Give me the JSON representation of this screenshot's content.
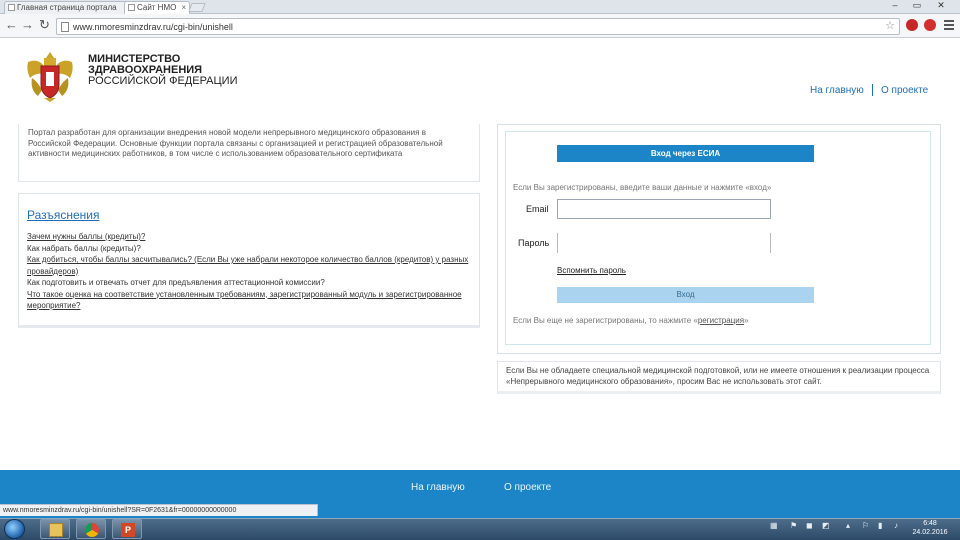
{
  "browser": {
    "tabs": [
      {
        "label": "Главная страница портала"
      },
      {
        "label": "Сайт НМО"
      }
    ],
    "url": "www.nmoresminzdrav.ru/cgi-bin/unishell"
  },
  "header": {
    "logo_lines": [
      "МИНИСТЕРСТВО",
      "ЗДРАВООХРАНЕНИЯ",
      "РОССИЙСКОЙ ФЕДЕРАЦИИ"
    ],
    "nav": [
      {
        "label": "На главную"
      },
      {
        "label": "О проекте"
      }
    ]
  },
  "about": {
    "text": "Портал разработан для организации внедрения новой модели непрерывного медицинского образования в Российской Федерации. Основные функции портала связаны с организацией и регистрацией образовательной активности медицинских работников, в том числе с использованием образовательного сертификата"
  },
  "faq": {
    "title": "Разъяснения",
    "items": [
      {
        "label": "Зачем нужны баллы (кредиты)?"
      },
      {
        "label": "Как набрать баллы (кредиты)?"
      },
      {
        "label": "Как добиться, чтобы баллы засчитывались? (Если Вы уже набрали некоторое количество баллов (кредитов) у разных провайдеров)"
      },
      {
        "label": "Как подготовить и отвечать отчет для предъявления аттестационной комиссии?"
      },
      {
        "label": "Что такое оценка на соответствие установленным требованиям, зарегистрированный модуль и зарегистрированное мероприятие?"
      }
    ]
  },
  "login": {
    "esia_button": "Вход через ЕСИА",
    "registered_hint": "Если Вы зарегистрированы, введите ваши данные и нажмите «вход»",
    "email_label": "Email",
    "email_value": "",
    "password_label": "Пароль",
    "password_value": "",
    "forgot_link": "Вспомнить пароль",
    "login_button": "Вход",
    "unregistered_hint_prefix": "Если Вы еще не зарегистрированы, то нажмите «",
    "register_link": "регистрация",
    "unregistered_hint_suffix": "»"
  },
  "notice": {
    "text": "Если Вы не обладаете специальной медицинской подготовкой, или не имеете отношения к реализации процесса «Непрерывного медицинского образования», просим Вас не использовать этот сайт."
  },
  "footer": {
    "nav": [
      {
        "label": "На главную"
      },
      {
        "label": "О проекте"
      }
    ]
  },
  "statusbar": {
    "text": "www.nmoresminzdrav.ru/cgi-bin/unishell?SR=0F2631&fr=00000000000000"
  },
  "taskbar": {
    "time": "6:48",
    "date": "24.02.2016"
  },
  "colors": {
    "brand_blue": "#1c85c8",
    "link_blue": "#1e6fb8",
    "login_button_bg": "#a9d3ee"
  }
}
